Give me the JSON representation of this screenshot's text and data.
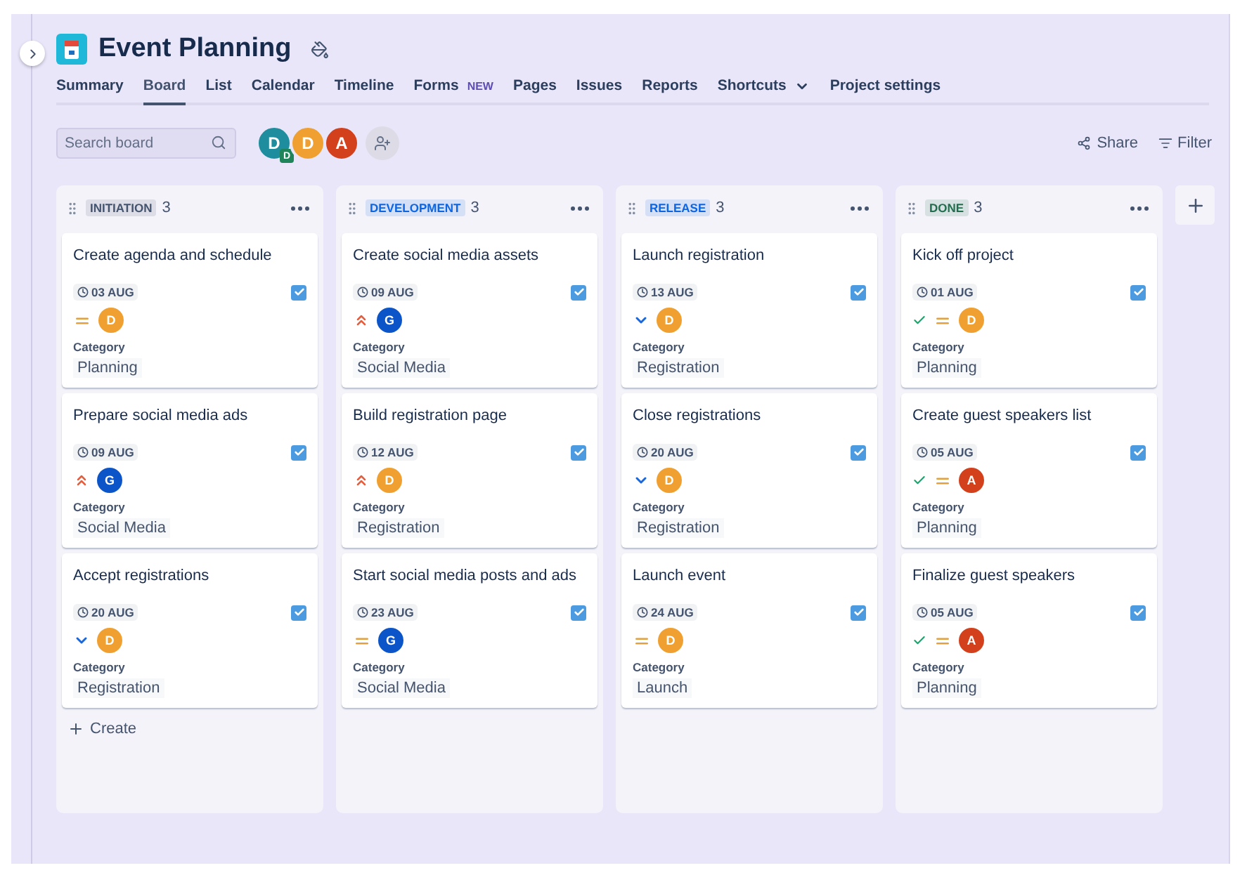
{
  "project": {
    "title": "Event Planning"
  },
  "tabs": [
    {
      "label": "Summary",
      "selected": false
    },
    {
      "label": "Board",
      "selected": true
    },
    {
      "label": "List",
      "selected": false
    },
    {
      "label": "Calendar",
      "selected": false
    },
    {
      "label": "Timeline",
      "selected": false
    },
    {
      "label": "Forms",
      "selected": false,
      "badge": "NEW"
    },
    {
      "label": "Pages",
      "selected": false
    },
    {
      "label": "Issues",
      "selected": false
    },
    {
      "label": "Reports",
      "selected": false
    },
    {
      "label": "Shortcuts",
      "selected": false,
      "dropdown": true
    },
    {
      "label": "Project settings",
      "selected": false
    }
  ],
  "search": {
    "placeholder": "Search board"
  },
  "people": [
    {
      "initial": "D",
      "color": "#1e8e9e",
      "badge": "D"
    },
    {
      "initial": "D",
      "color": "#f0a030"
    },
    {
      "initial": "A",
      "color": "#d2401c"
    }
  ],
  "actions": [
    {
      "kind": "share",
      "label": "Share"
    },
    {
      "kind": "filter",
      "label": "Filter"
    }
  ],
  "columns": [
    {
      "name": "INITIATION",
      "color": "#44546f",
      "count": "3",
      "create": "Create",
      "cards": [
        {
          "title": "Create agenda and schedule",
          "date": "03 AUG",
          "checked": true,
          "done": false,
          "priority": {
            "kind": "medium"
          },
          "assignee": {
            "initial": "D",
            "color": "#f0a030"
          },
          "field_label": "Category",
          "category": "Planning"
        },
        {
          "title": "Prepare social media ads",
          "date": "09 AUG",
          "checked": true,
          "done": false,
          "priority": {
            "kind": "high"
          },
          "assignee": {
            "initial": "G",
            "color": "#0c55c8"
          },
          "field_label": "Category",
          "category": "Social Media"
        },
        {
          "title": "Accept registrations",
          "date": "20 AUG",
          "checked": true,
          "done": false,
          "priority": {
            "kind": "low"
          },
          "assignee": {
            "initial": "D",
            "color": "#f0a030"
          },
          "field_label": "Category",
          "category": "Registration"
        }
      ]
    },
    {
      "name": "DEVELOPMENT",
      "color": "#0c66e4",
      "count": "3",
      "cards": [
        {
          "title": "Create social media assets",
          "date": "09 AUG",
          "checked": true,
          "done": false,
          "priority": {
            "kind": "high"
          },
          "assignee": {
            "initial": "G",
            "color": "#0c55c8"
          },
          "field_label": "Category",
          "category": "Social Media"
        },
        {
          "title": "Build registration page",
          "date": "12 AUG",
          "checked": true,
          "done": false,
          "priority": {
            "kind": "high"
          },
          "assignee": {
            "initial": "D",
            "color": "#f0a030"
          },
          "field_label": "Category",
          "category": "Registration"
        },
        {
          "title": "Start social media posts and ads",
          "date": "23 AUG",
          "checked": true,
          "done": false,
          "priority": {
            "kind": "medium"
          },
          "assignee": {
            "initial": "G",
            "color": "#0c55c8"
          },
          "field_label": "Category",
          "category": "Social Media"
        }
      ]
    },
    {
      "name": "RELEASE",
      "color": "#0c66e4",
      "count": "3",
      "cards": [
        {
          "title": "Launch registration",
          "date": "13 AUG",
          "checked": true,
          "done": false,
          "priority": {
            "kind": "low"
          },
          "assignee": {
            "initial": "D",
            "color": "#f0a030"
          },
          "field_label": "Category",
          "category": "Registration"
        },
        {
          "title": "Close registrations",
          "date": "20 AUG",
          "checked": true,
          "done": false,
          "priority": {
            "kind": "low"
          },
          "assignee": {
            "initial": "D",
            "color": "#f0a030"
          },
          "field_label": "Category",
          "category": "Registration"
        },
        {
          "title": "Launch event",
          "date": "24 AUG",
          "checked": true,
          "done": false,
          "priority": {
            "kind": "medium"
          },
          "assignee": {
            "initial": "D",
            "color": "#f0a030"
          },
          "field_label": "Category",
          "category": "Launch"
        }
      ]
    },
    {
      "name": "DONE",
      "color": "#216e4e",
      "count": "3",
      "cards": [
        {
          "title": "Kick off project",
          "date": "01 AUG",
          "checked": true,
          "done": true,
          "priority": {
            "kind": "medium"
          },
          "assignee": {
            "initial": "D",
            "color": "#f0a030"
          },
          "field_label": "Category",
          "category": "Planning"
        },
        {
          "title": "Create guest speakers list",
          "date": "05 AUG",
          "checked": true,
          "done": true,
          "priority": {
            "kind": "medium"
          },
          "assignee": {
            "initial": "A",
            "color": "#d2401c"
          },
          "field_label": "Category",
          "category": "Planning"
        },
        {
          "title": "Finalize guest speakers",
          "date": "05 AUG",
          "checked": true,
          "done": true,
          "priority": {
            "kind": "medium"
          },
          "assignee": {
            "initial": "A",
            "color": "#d2401c"
          },
          "field_label": "Category",
          "category": "Planning"
        }
      ]
    }
  ]
}
